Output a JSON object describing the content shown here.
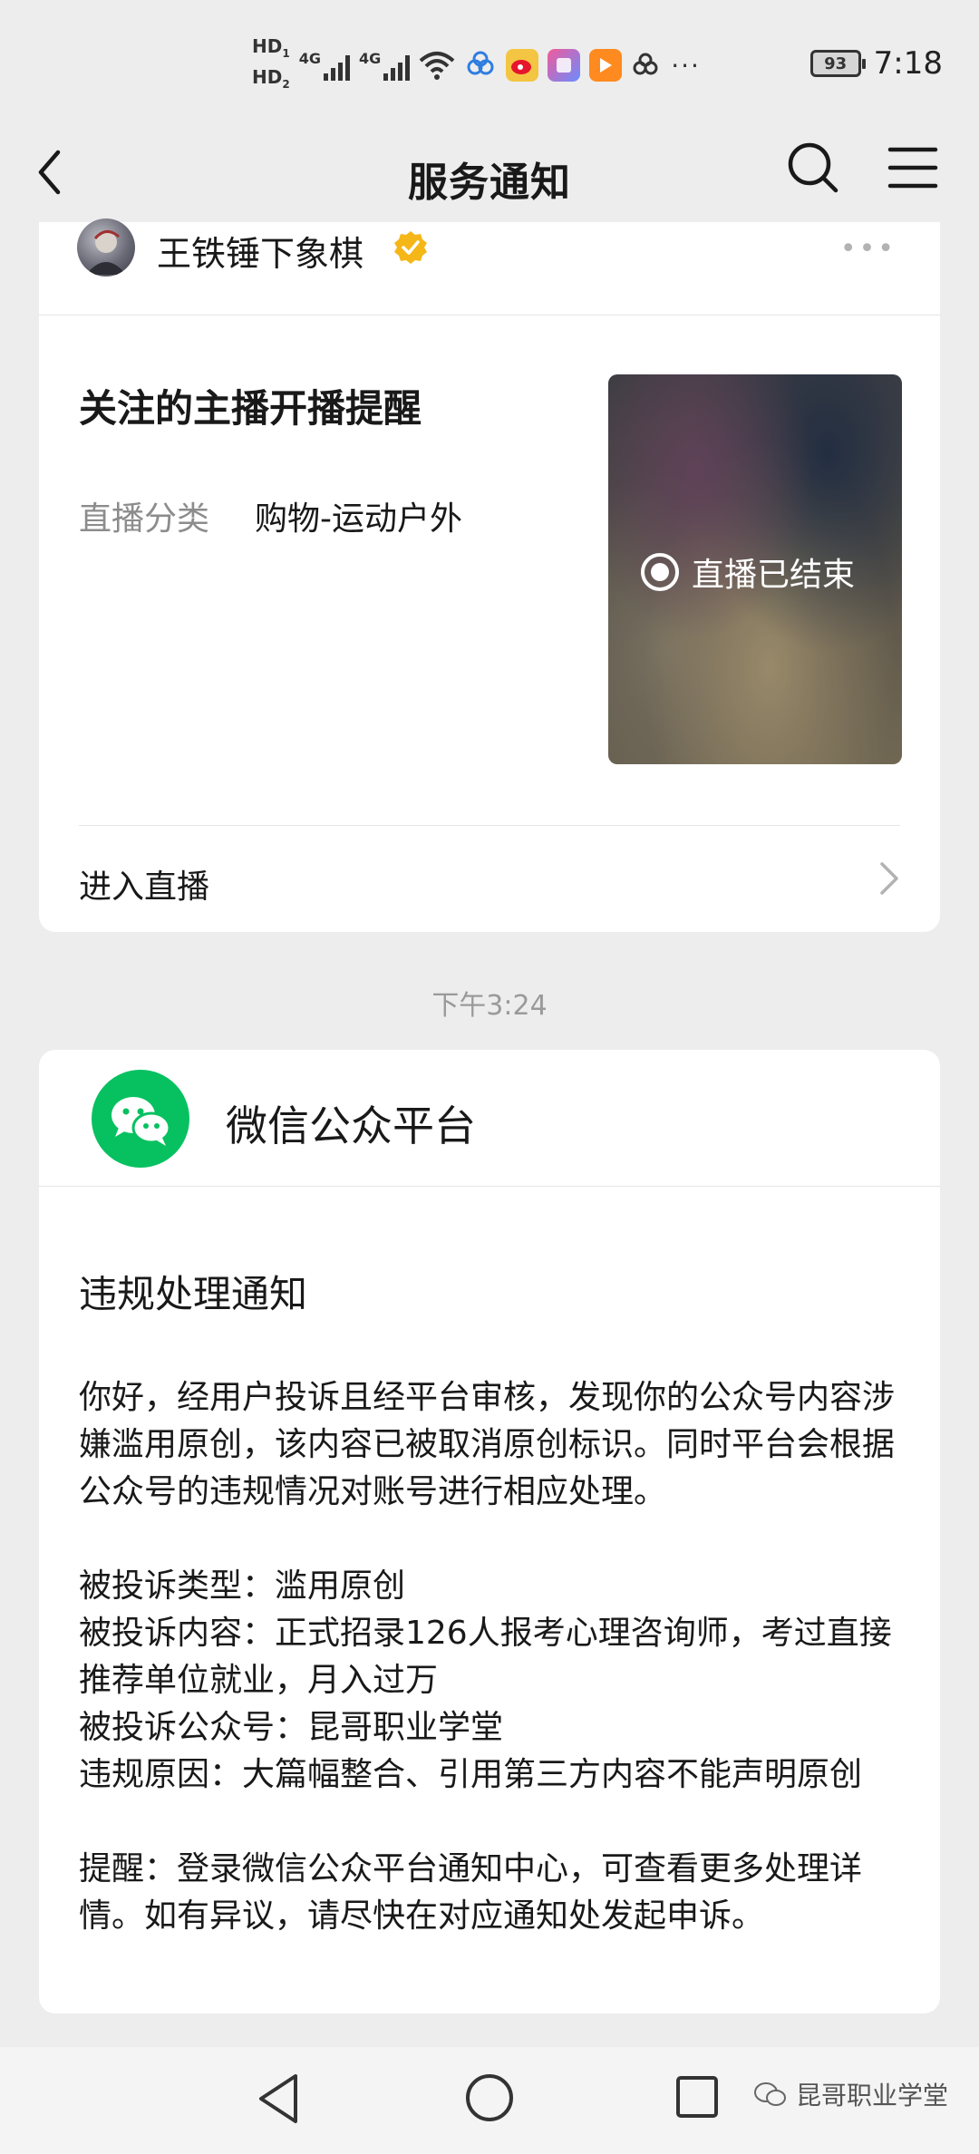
{
  "status_bar": {
    "hd1": "HD",
    "hd1_sub": "1",
    "hd2": "HD",
    "hd2_sub": "2",
    "network1": "4G",
    "network2": "4G",
    "more": "···",
    "battery": "93",
    "time": "7:18"
  },
  "navbar": {
    "title": "服务通知"
  },
  "card1": {
    "sender_name": "王铁锤下象棋",
    "more": "•••",
    "title": "关注的主播开播提醒",
    "meta_label": "直播分类",
    "meta_value": "购物-运动户外",
    "thumbnail_status": "直播已结束",
    "enter_label": "进入直播"
  },
  "timestamp": "下午3:24",
  "card2": {
    "sender_name": "微信公众平台",
    "title": "违规处理通知",
    "body": "你好，经用户投诉且经平台审核，发现你的公众号内容涉嫌滥用原创，该内容已被取消原创标识。同时平台会根据公众号的违规情况对账号进行相应处理。\n\n被投诉类型：滥用原创\n被投诉内容：正式招录126人报考心理咨询师，考过直接推荐单位就业，月入过万\n被投诉公众号：昆哥职业学堂\n违规原因：大篇幅整合、引用第三方内容不能声明原创\n\n提醒：登录微信公众平台通知中心，可查看更多处理详情。如有异议，请尽快在对应通知处发起申诉。"
  },
  "watermark": "昆哥职业学堂",
  "colors": {
    "background": "#ededed",
    "card": "#ffffff",
    "wechat_green": "#07c160",
    "verified_gold": "#f5b718",
    "secondary_text": "#8c8c8c"
  }
}
